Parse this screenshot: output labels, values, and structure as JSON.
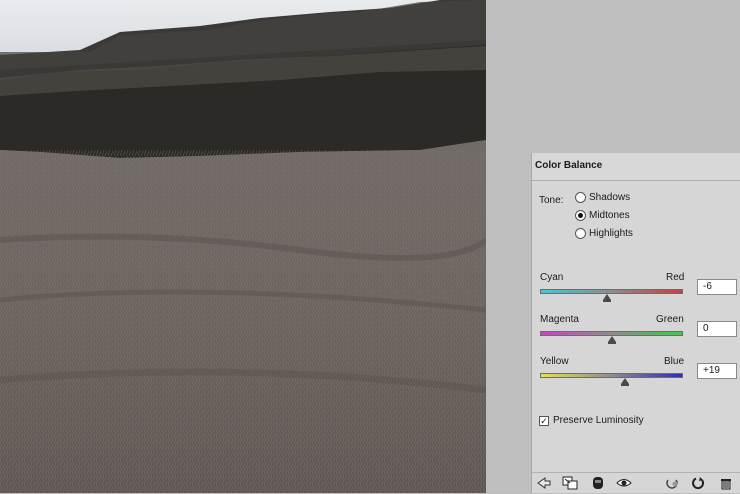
{
  "panel": {
    "title": "Color Balance",
    "tone_label": "Tone:",
    "tones": [
      {
        "label": "Shadows",
        "selected": false
      },
      {
        "label": "Midtones",
        "selected": true
      },
      {
        "label": "Highlights",
        "selected": false
      }
    ],
    "sliders": [
      {
        "left": "Cyan",
        "right": "Red",
        "value": "-6",
        "numeric": -6
      },
      {
        "left": "Magenta",
        "right": "Green",
        "value": "0",
        "numeric": 0
      },
      {
        "left": "Yellow",
        "right": "Blue",
        "value": "+19",
        "numeric": 19
      }
    ],
    "preserve_luminosity": {
      "label": "Preserve Luminosity",
      "checked": true
    },
    "check_mark": "✓"
  },
  "toolbar_icons": [
    "back-arrow-icon",
    "clip-to-layer-icon",
    "mask-icon",
    "eye-visibility-icon",
    "reset-previous-icon",
    "reset-icon",
    "trash-icon"
  ],
  "colors": {
    "panel_bg": "#d6d6d6",
    "side_bg": "#bfbfbf"
  }
}
